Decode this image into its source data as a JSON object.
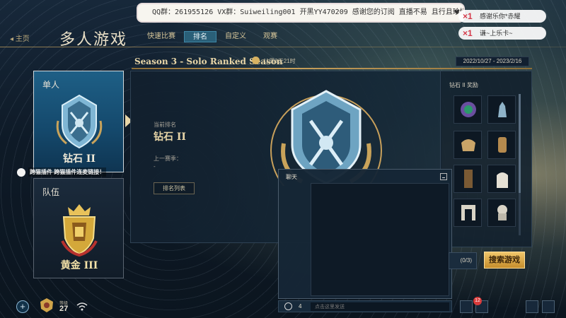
{
  "stream": {
    "banner": "QQ群：261955126 VX群：Suiweiling001 开黑YY470209 感谢您的订阅 直播不易 且行且珍惜",
    "gifts": [
      {
        "mult": "×1",
        "name": "感谢乐你*赤耀"
      },
      {
        "mult": "×1",
        "name": "谦~上乐卡~"
      }
    ],
    "live_badge": "跨猫插件 跨猫插件连麦链接！"
  },
  "nav": {
    "back": "主页",
    "title": "多人游戏",
    "tabs": [
      {
        "label": "快速比赛",
        "active": false
      },
      {
        "label": "排名",
        "active": true
      },
      {
        "label": "自定义",
        "active": false
      },
      {
        "label": "观赛",
        "active": false
      }
    ]
  },
  "season": {
    "title": "Season 3 - Solo Ranked Season",
    "time_left": "11周3天21时",
    "date_range": "2022/10/27 - 2023/2/16"
  },
  "cards": {
    "solo": {
      "label": "单人",
      "rank": "钻石 II"
    },
    "team": {
      "label": "队伍",
      "rank": "黄金 III"
    }
  },
  "main": {
    "current_label": "当前排名",
    "current_rank": "钻石 II",
    "last_label": "上一赛季：",
    "last_value": "-",
    "list_button": "排名列表"
  },
  "rewards": {
    "header": "钻石 II 奖励",
    "items": [
      "reward-portrait",
      "reward-statue",
      "reward-emblem-gold",
      "reward-emblem-bronze",
      "reward-banner",
      "reward-window",
      "reward-arch",
      "reward-sculpture"
    ]
  },
  "chat": {
    "title": "聊天",
    "members": "4",
    "placeholder": "点击这里发送"
  },
  "bottom": {
    "party_label": "(0/3)",
    "search_button": "搜索游戏",
    "add_button": "+",
    "level_label": "等级",
    "level": "27",
    "notifications": "12"
  },
  "colors": {
    "accent_gold": "#c8a05b",
    "search_button": "#e0a94a",
    "active_tab": "#2a5f78",
    "solo_card": "#1e5f86"
  }
}
